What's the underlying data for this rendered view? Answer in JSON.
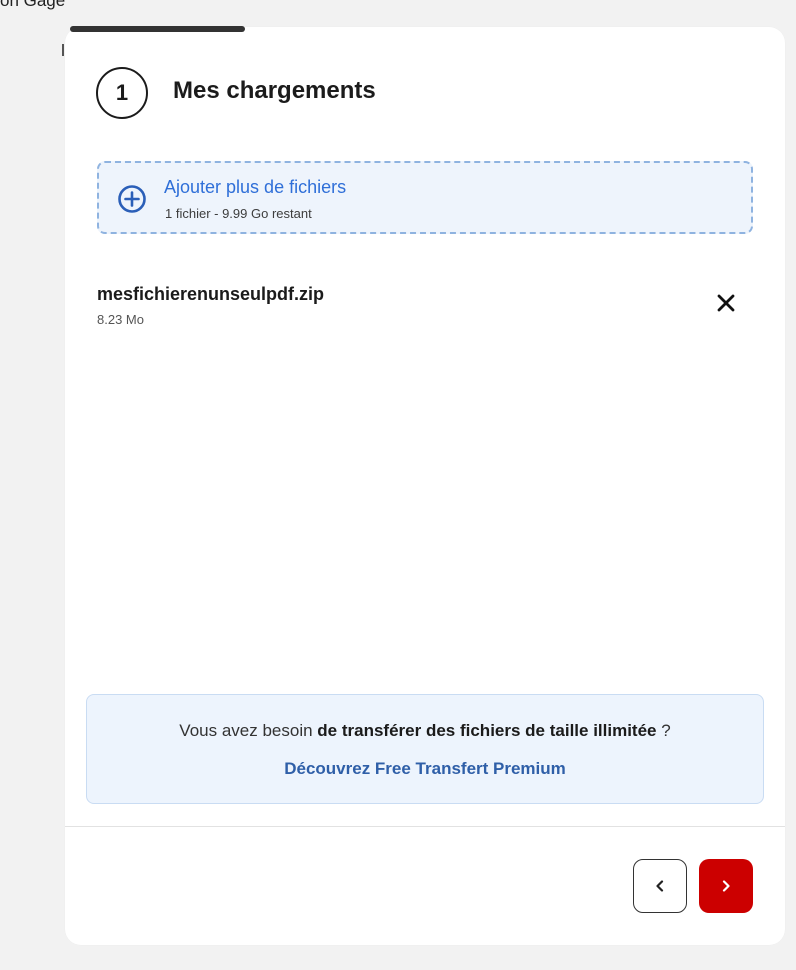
{
  "clipped_header_text": "on Gage",
  "step": {
    "number": "1",
    "title": "Mes chargements",
    "progress": 0.25
  },
  "add_files": {
    "label": "Ajouter plus de fichiers",
    "sub": "1 fichier - 9.99 Go restant",
    "icon": "plus-circle-icon"
  },
  "files": [
    {
      "name": "mesfichierenunseulpdf.zip",
      "size": "8.23 Mo"
    }
  ],
  "promo": {
    "text_before": "Vous avez besoin",
    "text_bold": "de transférer des fichiers de taille illimitée",
    "text_after": "?",
    "link": "Découvrez Free Transfert Premium"
  },
  "nav": {
    "prev_icon": "chevron-left-icon",
    "next_icon": "chevron-right-icon"
  },
  "colors": {
    "accent": "#cc0000",
    "link": "#2f6fd8",
    "promo_bg": "#edf4fd"
  }
}
